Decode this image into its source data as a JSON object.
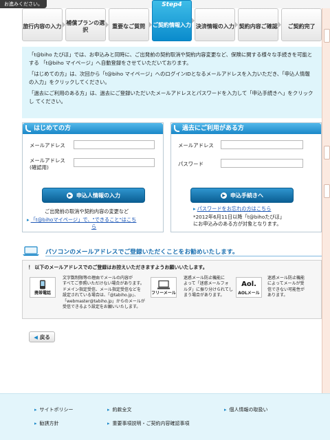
{
  "top_notice": "お進みください。",
  "steps": [
    {
      "label": "旅行内容の入力",
      "no": ""
    },
    {
      "label": "補償プランの選択",
      "no": ""
    },
    {
      "label": "重要なご質問",
      "no": ""
    },
    {
      "label": "ご契約情報入力",
      "no": "Step4"
    },
    {
      "label": "決済情報の入力",
      "no": ""
    },
    {
      "label": "契約内容ご確認",
      "no": ""
    },
    {
      "label": "ご契約完了",
      "no": ""
    }
  ],
  "info": {
    "p1": "「t@biho たびほ」では、お申込みと同時に、ご出発前の契約取消や契約内容変更など、保険に関する様々な手続きを可能とする 「t@biho マイページ」へ自動登録をさせていただいております。",
    "p2": "「はじめての方」は、次回から「t@biho マイページ」へのログインIDとなるメールアドレスを入力いただき、「申込人情報の入力」をクリックしてください。",
    "p3": "「過去にご利用のある方」は、過去にご登録いただいたメールアドレスとパスワードを入力して「申込手続きへ」をクリックし てください。"
  },
  "first_panel": {
    "title": "はじめての方",
    "email_label": "メールアドレス",
    "email_confirm_label_1": "メールアドレス",
    "email_confirm_label_2": "(確認用)",
    "email_value": "",
    "email_confirm_value": "",
    "submit_label": "申込人情報の入力",
    "note_1": "ご出発前の取消や契約内容の変更など",
    "link_1": "「t@bihoマイページ」で、\"できること\"はこち",
    "link_2": "ら"
  },
  "return_panel": {
    "title": "過去にご利用がある方",
    "email_label": "メールアドレス",
    "password_label": "パスワード",
    "email_value": "",
    "password_value": "",
    "submit_label": "申込手続きへ",
    "forgot_link": "パスワードをお忘れの方はこちら",
    "note_1": "*2012年6月11日以降「t@bihoたびほ」",
    "note_2": "にお申込みのある方が対象となります。"
  },
  "recommend": {
    "title": "パソコンのメールアドレスでご登録いただくことをお勧めいたします。",
    "note": "！ 以下のメールアドレスでのご登録はお控えいただきますようお願いいたします。",
    "items": [
      {
        "icon_label": "携帯電話",
        "lines": [
          "文字数制限等の理由でメールの内容が",
          "すべてご参照いただけない場合があります。",
          "ドメイン指定受信、メール指定受信などを",
          "設定されている場合は、「@tabiho.jp」、",
          "「webmaster@tabiho.jp」からのメールが",
          "受信できるよう設定をお願いいたします。"
        ]
      },
      {
        "icon_label": "フリーメール",
        "lines": [
          "迷惑メール防止機能に",
          "よって「迷惑メールフォ",
          "ルダ」に振り分けられてし",
          "まう場合があります。"
        ]
      },
      {
        "icon_label": "AOLメール",
        "icon_mark": "Aol.",
        "lines": [
          "迷惑メール防止機能",
          "によってメールが受",
          "信できない可能性が",
          "あります。"
        ]
      }
    ]
  },
  "back_label": "戻る",
  "footer": {
    "links": [
      "サイトポリシー",
      "約款全文",
      "個人情報の取扱い",
      "勧誘方針",
      "重要事項説明・ご契約内容確認事項"
    ]
  },
  "colors": {
    "accent": "#1a87c8",
    "info_bg": "#dff5fb",
    "footer_bg": "#e3f5fb"
  }
}
